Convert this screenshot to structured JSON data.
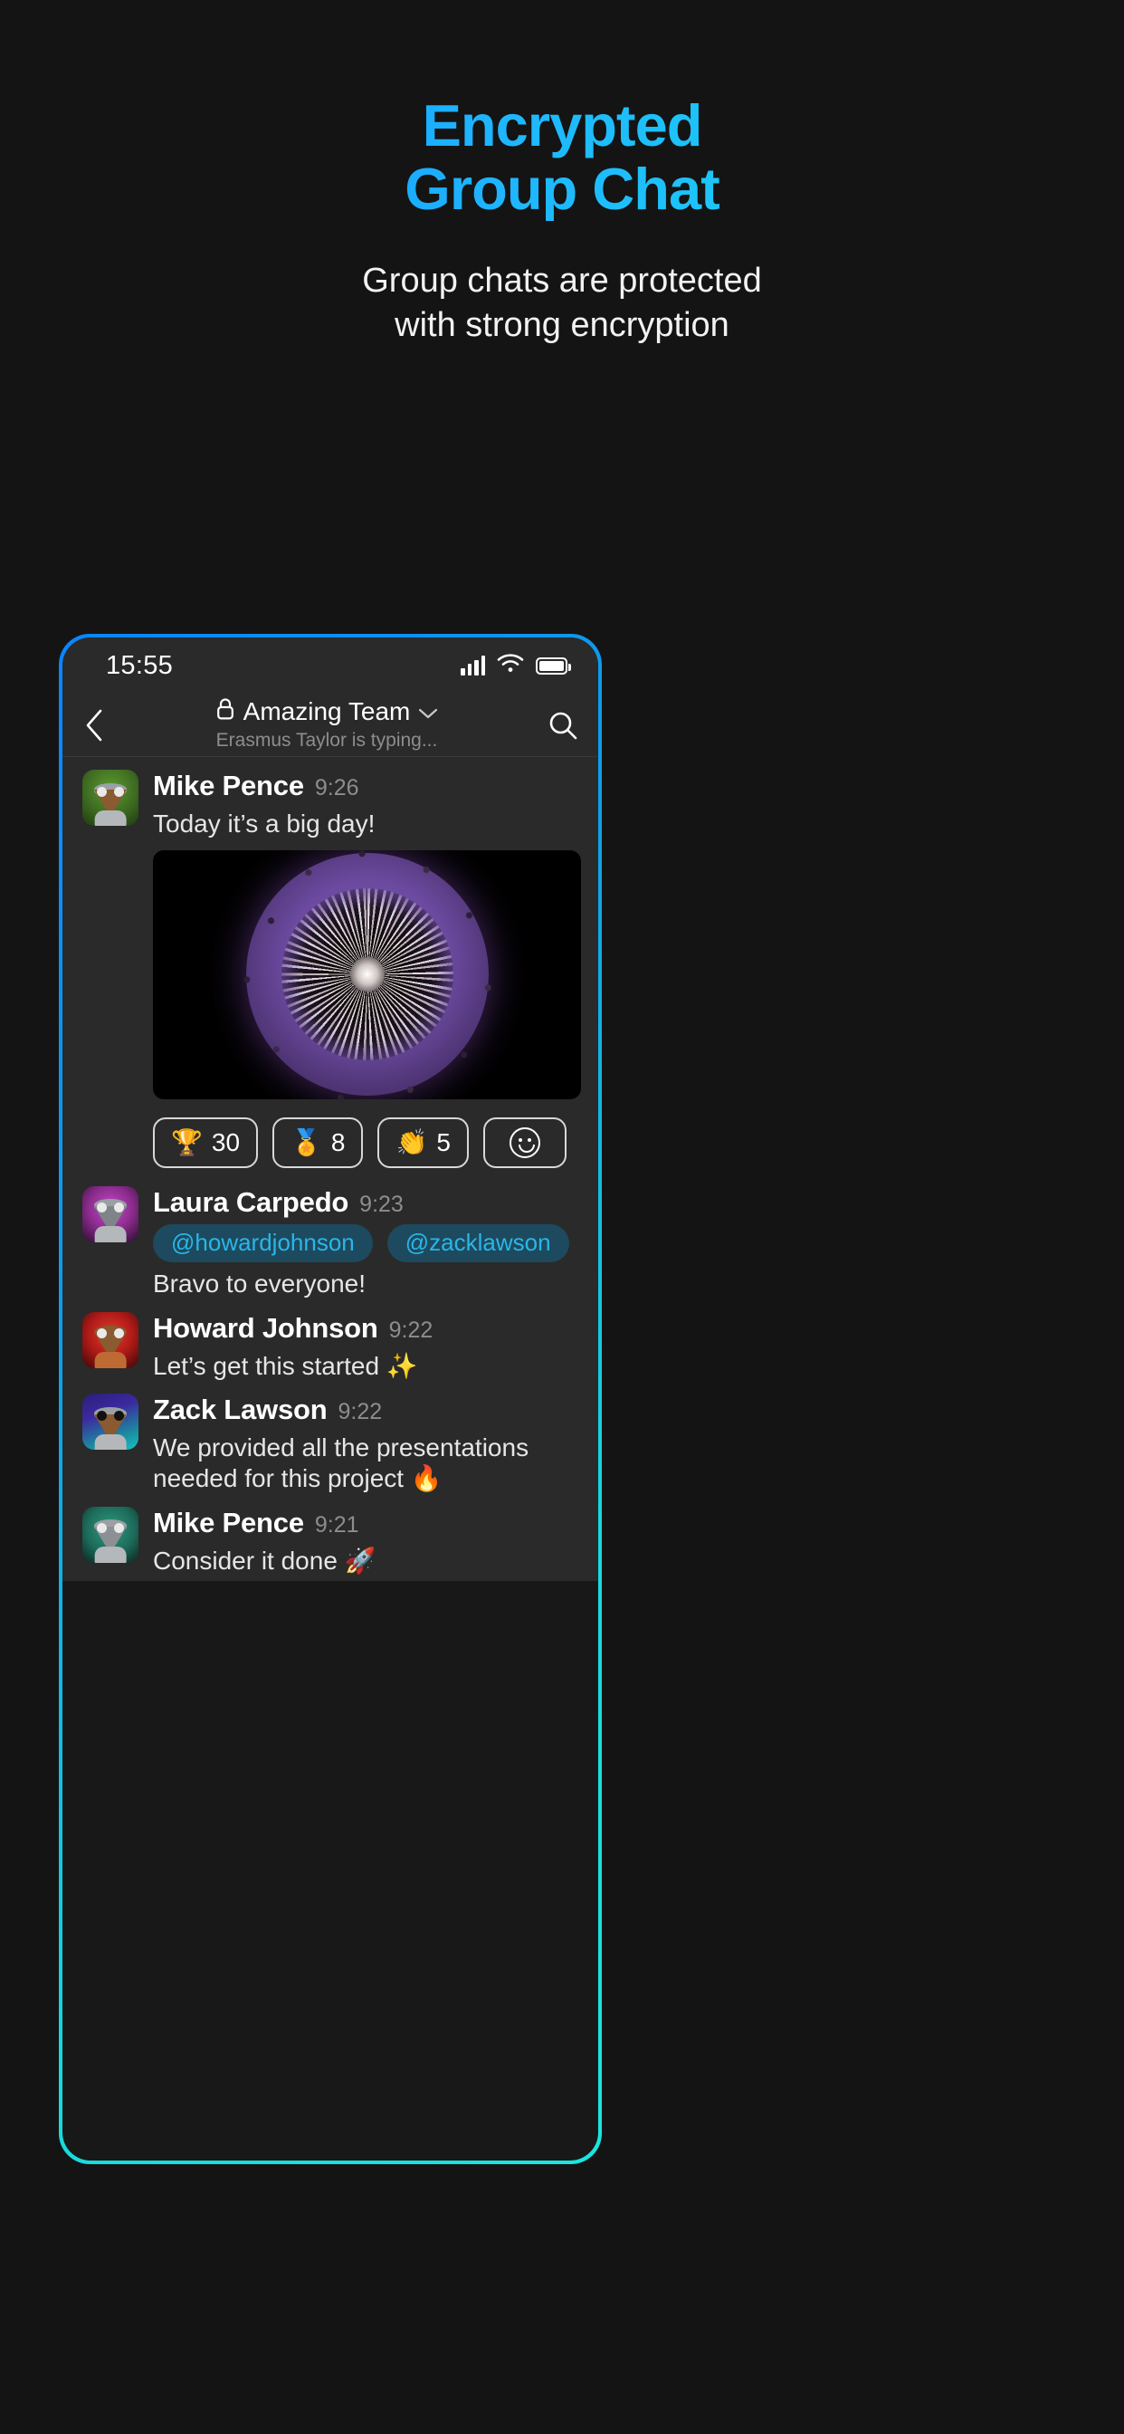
{
  "promo": {
    "title_line1": "Encrypted",
    "title_line2": "Group Chat",
    "subtitle_line1": "Group chats are protected",
    "subtitle_line2": "with strong encryption",
    "title_gradient_from": "#0a84ff",
    "title_gradient_to": "#18e0e8",
    "background": "#141414"
  },
  "phone": {
    "frame_gradient_from": "#0a84ff",
    "frame_gradient_to": "#19e6e0",
    "statusbar": {
      "time": "15:55",
      "signal_icon": "signal-bars-icon",
      "wifi_icon": "wifi-icon",
      "battery_icon": "battery-full-icon"
    },
    "header": {
      "back_icon": "chevron-left-icon",
      "lock_icon": "lock-icon",
      "title": "Amazing Team",
      "chevron_icon": "chevron-down-icon",
      "subtitle": "Erasmus Taylor is typing...",
      "search_icon": "search-icon"
    }
  },
  "messages": [
    {
      "id": "msg-mike-926",
      "avatar_name": "avatar-mike-pence",
      "avatar_bg": "#3e6b22",
      "name": "Mike Pence",
      "time": "9:26",
      "text": "Today it’s a big day!",
      "has_media": true,
      "media_name": "nft-orb-image",
      "reactions": [
        {
          "emoji": "🏆",
          "icon_name": "trophy-emoji",
          "count": "30"
        },
        {
          "emoji": "🏅",
          "icon_name": "medal-emoji",
          "count": "8"
        },
        {
          "emoji": "👏",
          "icon_name": "clap-emoji",
          "count": "5"
        }
      ],
      "add_reaction_icon": "smiley-face-icon"
    },
    {
      "id": "msg-laura-923",
      "avatar_name": "avatar-laura-carpedo",
      "avatar_bg": "#8c2c8e",
      "name": "Laura Carpedo",
      "time": "9:23",
      "mentions": [
        "@howardjohnson",
        "@zacklawson"
      ],
      "text": "Bravo to everyone!",
      "has_media": false
    },
    {
      "id": "msg-howard-922",
      "avatar_name": "avatar-howard-johnson",
      "avatar_bg": "#b01b18",
      "name": "Howard Johnson",
      "time": "9:22",
      "text": "Let’s get this started ✨",
      "has_media": false
    },
    {
      "id": "msg-zack-922",
      "avatar_name": "avatar-zack-lawson",
      "avatar_bg": "#2b1d7a",
      "name": "Zack Lawson",
      "time": "9:22",
      "text": "We provided all the presentations needed for this project 🔥",
      "has_media": false
    },
    {
      "id": "msg-mike-921",
      "avatar_name": "avatar-mike-pence-2",
      "avatar_bg": "#1d6b5a",
      "name": "Mike Pence",
      "time": "9:21",
      "text": "Consider it done 🚀",
      "has_media": false
    }
  ],
  "mention_colors": {
    "bg": "#1d4a5e",
    "text": "#29b6e8"
  }
}
